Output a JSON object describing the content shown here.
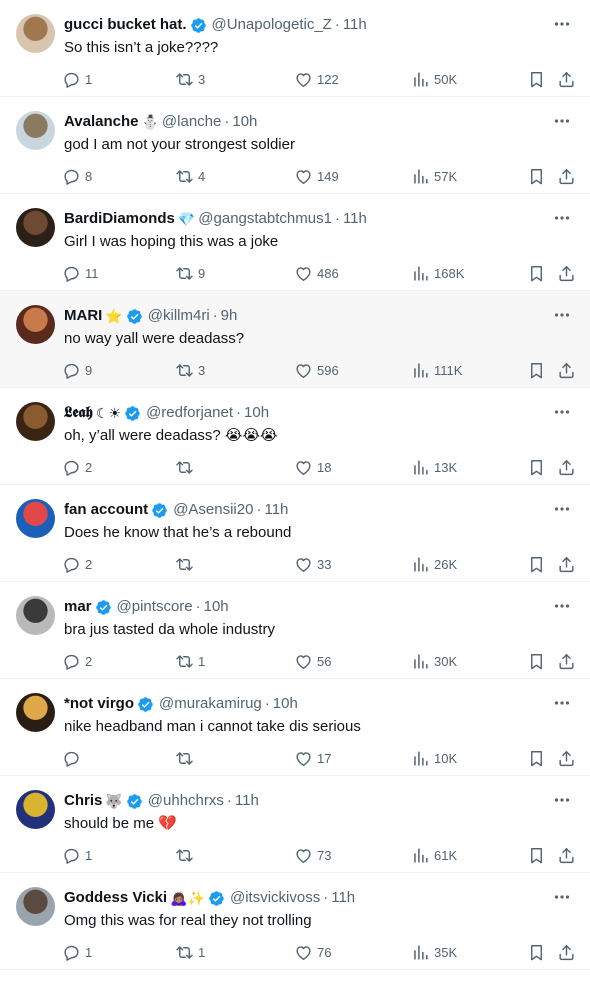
{
  "colors": {
    "text": "#0f1419",
    "muted": "#536471",
    "verified": "#1d9bf0",
    "divider": "#eff3f4",
    "highlight": "#f7f7f7"
  },
  "icons": {
    "reply": "speech-bubble",
    "retweet": "retweet-arrows",
    "like": "heart",
    "views": "bar-chart",
    "bookmark": "bookmark",
    "share": "share-upload",
    "more": "ellipsis",
    "verified": "blue-check-badge"
  },
  "tweets": [
    {
      "name": "gucci bucket hat.",
      "emoji": "",
      "verified": true,
      "handle": "@Unapologetic_Z",
      "dot": "·",
      "time": "11h",
      "text": "So this isn’t a joke????",
      "replies": "1",
      "retweets": "3",
      "likes": "122",
      "views": "50K",
      "avatar": [
        "#d8c5b0",
        "#a07850"
      ]
    },
    {
      "name": "Avalanche",
      "emoji": "⛄",
      "verified": false,
      "handle": "@lanche",
      "dot": "·",
      "time": "10h",
      "text": "god I am not your strongest soldier",
      "replies": "8",
      "retweets": "4",
      "likes": "149",
      "views": "57K",
      "avatar": [
        "#c9d6de",
        "#8a7a62"
      ]
    },
    {
      "name": "BardiDiamonds",
      "emoji": "💎",
      "verified": false,
      "handle": "@gangstabtchmus1",
      "dot": "·",
      "time": "11h",
      "text": "Girl I was hoping this was a joke",
      "replies": "11",
      "retweets": "9",
      "likes": "486",
      "views": "168K",
      "avatar": [
        "#2a2018",
        "#6e4a34"
      ]
    },
    {
      "name": "MARI",
      "emoji": "⭐",
      "verified": true,
      "handle": "@killm4ri",
      "dot": "·",
      "time": "9h",
      "text": "no way yall were deadass?",
      "replies": "9",
      "retweets": "3",
      "likes": "596",
      "views": "111K",
      "avatar": [
        "#5a2a1c",
        "#c77a4a"
      ],
      "highlight": true
    },
    {
      "name": "𝕷𝖊𝖆𝖍",
      "emoji": "☾☀",
      "verified": true,
      "handle": "@redforjanet",
      "dot": "·",
      "time": "10h",
      "text": "oh, y’all were deadass? 😭😭😭",
      "replies": "2",
      "retweets": "",
      "likes": "18",
      "views": "13K",
      "avatar": [
        "#3a2414",
        "#8a5a30"
      ]
    },
    {
      "name": "fan account",
      "emoji": "",
      "verified": true,
      "handle": "@Asensii20",
      "dot": "·",
      "time": "11h",
      "text": "Does he know that he’s a rebound",
      "replies": "2",
      "retweets": "",
      "likes": "33",
      "views": "26K",
      "avatar": [
        "#1c5fb8",
        "#e2484a"
      ]
    },
    {
      "name": "mar",
      "emoji": "",
      "verified": true,
      "handle": "@pintscore",
      "dot": "·",
      "time": "10h",
      "text": "bra jus tasted da whole industry",
      "replies": "2",
      "retweets": "1",
      "likes": "56",
      "views": "30K",
      "avatar": [
        "#b9b9b9",
        "#3a3a3a"
      ]
    },
    {
      "name": "*not virgo",
      "emoji": "",
      "verified": true,
      "handle": "@murakamirug",
      "dot": "·",
      "time": "10h",
      "text": "nike headband man i cannot take dis serious",
      "replies": "",
      "retweets": "",
      "likes": "17",
      "views": "10K",
      "avatar": [
        "#2a1e14",
        "#e0a848"
      ]
    },
    {
      "name": "Chris",
      "emoji": "🐺",
      "verified": true,
      "handle": "@uhhchrxs",
      "dot": "·",
      "time": "11h",
      "text": "should be me 💔",
      "replies": "1",
      "retweets": "",
      "likes": "73",
      "views": "61K",
      "avatar": [
        "#23317a",
        "#d8b430"
      ]
    },
    {
      "name": "Goddess Vicki",
      "emoji": "🙇🏽‍♀️✨",
      "verified": true,
      "handle": "@itsvickivoss",
      "dot": "·",
      "time": "11h",
      "text": "Omg this was for real they not trolling",
      "replies": "1",
      "retweets": "1",
      "likes": "76",
      "views": "35K",
      "avatar": [
        "#9aa4ac",
        "#5a4a40"
      ]
    }
  ]
}
